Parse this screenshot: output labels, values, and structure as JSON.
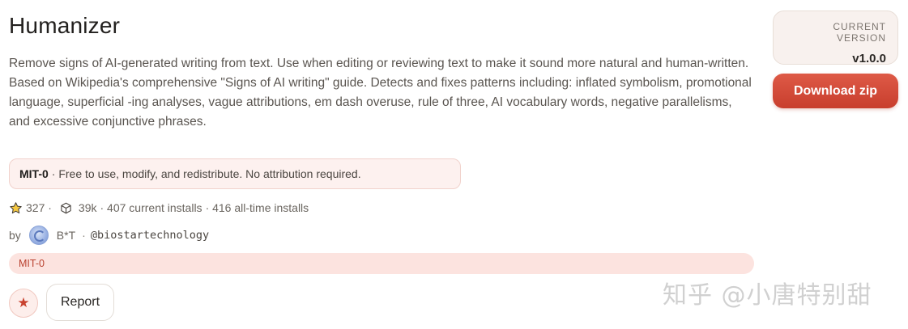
{
  "skill": {
    "title": "Humanizer",
    "description": "Remove signs of AI-generated writing from text. Use when editing or reviewing text to make it sound more natural and human-written. Based on Wikipedia's comprehensive \"Signs of AI writing\" guide. Detects and fixes patterns including: inflated symbolism, promotional language, superficial -ing analyses, vague attributions, em dash overuse, rule of three, AI vocabulary words, negative parallelisms, and excessive conjunctive phrases."
  },
  "license": {
    "name": "MIT-0",
    "text": "· Free to use, modify, and redistribute. No attribution required."
  },
  "stats": {
    "stars": "327 ·",
    "downloads": "39k",
    "current_installs": "· 407 current installs",
    "all_time_installs": "· 416 all-time installs"
  },
  "author": {
    "by_label": "by",
    "name": "B*T",
    "separator": "·",
    "handle": "@biostartechnology"
  },
  "tags": [
    "MIT-0"
  ],
  "actions": {
    "star_glyph": "★",
    "report_label": "Report",
    "download_label": "Download zip"
  },
  "version": {
    "label": "CURRENT VERSION",
    "value": "v1.0.0"
  },
  "watermark": "知乎 @小唐特别甜",
  "colors": {
    "accent": "#d14a37",
    "tag_bg": "#fce3df",
    "license_bg": "#fdf1ef"
  }
}
